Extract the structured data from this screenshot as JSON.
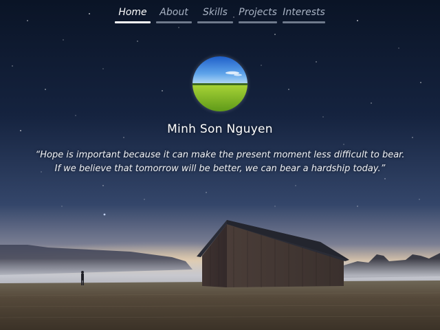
{
  "nav": {
    "items": [
      {
        "label": "Home",
        "active": true
      },
      {
        "label": "About",
        "active": false
      },
      {
        "label": "Skills",
        "active": false
      },
      {
        "label": "Projects",
        "active": false
      },
      {
        "label": "Interests",
        "active": false
      }
    ]
  },
  "profile": {
    "name": "Minh Son Nguyen",
    "avatar_icon": "landscape-avatar"
  },
  "quote": {
    "line1": "“Hope is important because it can make the present moment less difficult to bear.",
    "line2": "If we believe that tomorrow will be better, we can bear a hardship today.”"
  },
  "colors": {
    "sky_top": "#0b1528",
    "sky_mid": "#2a3a5a",
    "horizon_glow": "#d9c3a8",
    "fog": "#b9bcc6",
    "field": "#4d4436",
    "barn": "#3a3130",
    "roof": "#2b2d37",
    "nav_active": "#ffffff",
    "nav_inactive": "#a9b3c4"
  }
}
